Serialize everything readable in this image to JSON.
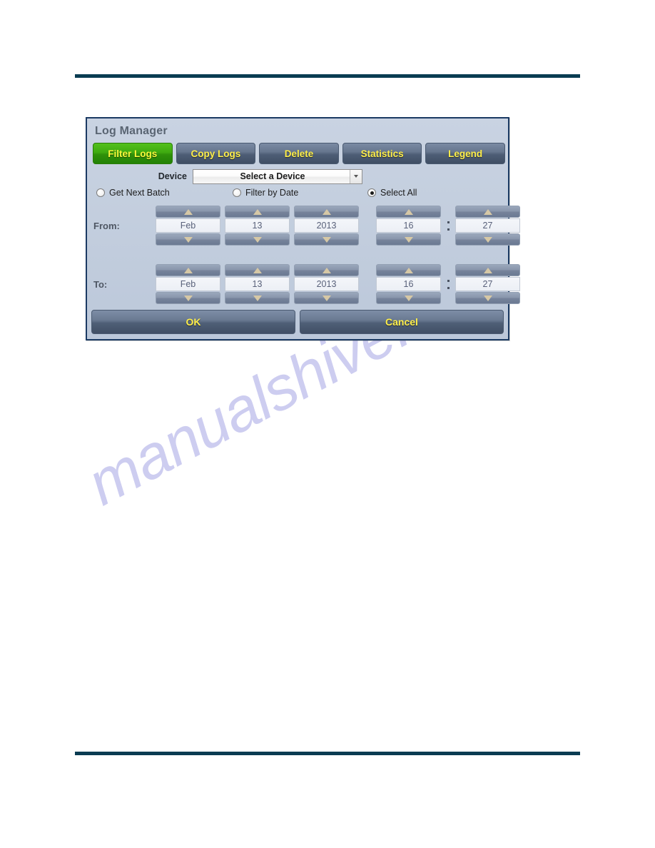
{
  "page": {
    "watermark": "manualshive.com",
    "rule_color": "#0a3c52"
  },
  "dialog": {
    "title": "Log Manager",
    "tabs": [
      {
        "label": "Filter Logs",
        "active": true
      },
      {
        "label": "Copy Logs",
        "active": false
      },
      {
        "label": "Delete",
        "active": false
      },
      {
        "label": "Statistics",
        "active": false
      },
      {
        "label": "Legend",
        "active": false
      }
    ],
    "device": {
      "label": "Device",
      "selected": "Select a Device",
      "caret_icon": "chevron-down-icon"
    },
    "modes": [
      {
        "label": "Get Next Batch",
        "checked": false
      },
      {
        "label": "Filter by Date",
        "checked": false
      },
      {
        "label": "Select All",
        "checked": true
      }
    ],
    "from": {
      "label": "From:",
      "month": "Feb",
      "day": "13",
      "year": "2013",
      "hour": "16",
      "minute": "27"
    },
    "to": {
      "label": "To:",
      "month": "Feb",
      "day": "13",
      "year": "2013",
      "hour": "16",
      "minute": "27"
    },
    "footer": {
      "ok_label": "OK",
      "cancel_label": "Cancel"
    },
    "colors": {
      "accent_active_tab": "#3faa10",
      "button_text": "#ffef4a",
      "dialog_border": "#1b3a63",
      "dialog_bg": "#c3cede"
    }
  }
}
